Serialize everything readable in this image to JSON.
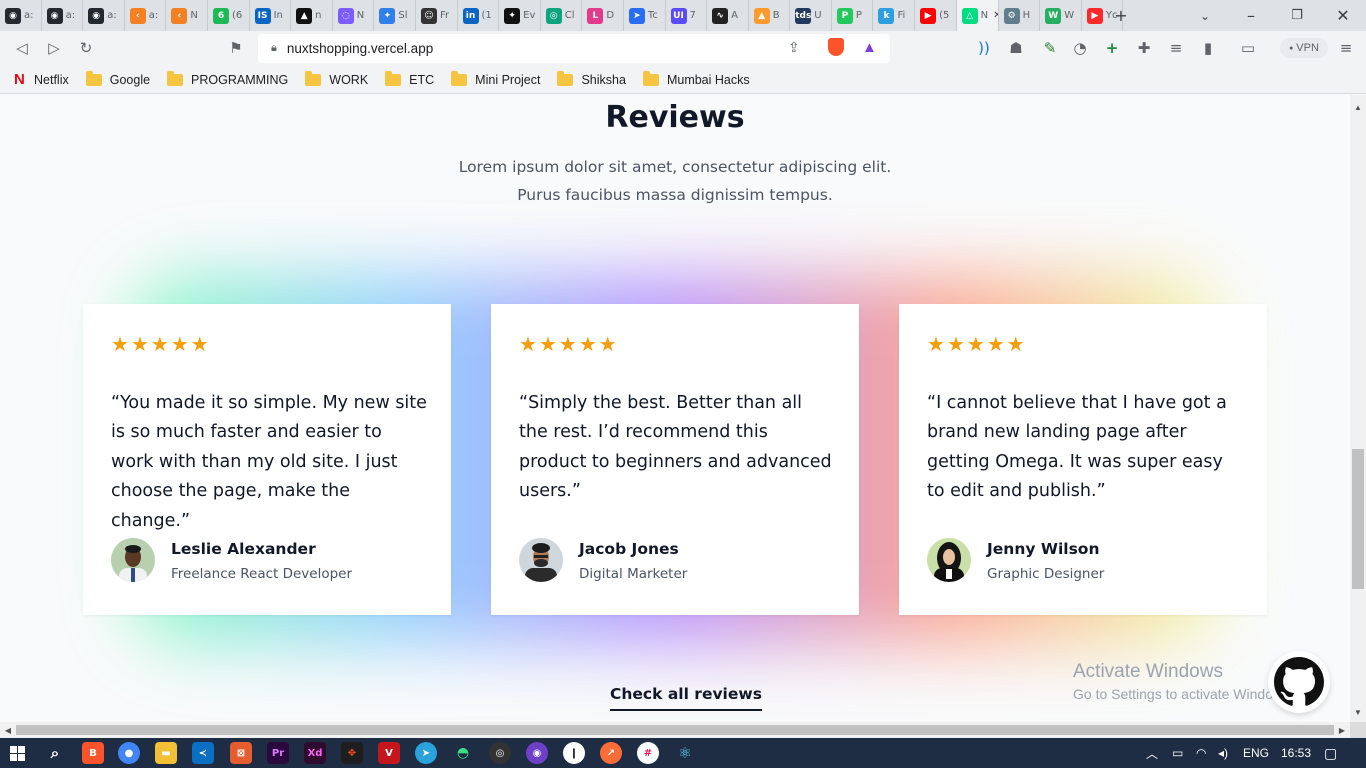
{
  "browser": {
    "tabs": [
      {
        "icon": "github-icon",
        "color": "#24292f",
        "glyph": "◉",
        "label": "a:"
      },
      {
        "icon": "github-icon",
        "color": "#24292f",
        "glyph": "◉",
        "label": "a:"
      },
      {
        "icon": "github-icon",
        "color": "#24292f",
        "glyph": "◉",
        "label": "a:"
      },
      {
        "icon": "stack-icon",
        "color": "#f48024",
        "glyph": "‹",
        "label": "a:"
      },
      {
        "icon": "stack-icon",
        "color": "#f48024",
        "glyph": "‹",
        "label": "N"
      },
      {
        "icon": "counter-icon",
        "color": "#1db954",
        "glyph": "6",
        "label": "(6"
      },
      {
        "icon": "is-icon",
        "color": "#0a66c2",
        "glyph": "IS",
        "label": "In"
      },
      {
        "icon": "triangle-icon",
        "color": "#111111",
        "glyph": "▲",
        "label": "n"
      },
      {
        "icon": "chat-icon",
        "color": "#7c5cff",
        "glyph": "◌",
        "label": "N"
      },
      {
        "icon": "sketch-icon",
        "color": "#2f80ed",
        "glyph": "✦",
        "label": "Sl"
      },
      {
        "icon": "reddit-icon",
        "color": "#333333",
        "glyph": "☺",
        "label": "Fr"
      },
      {
        "icon": "linkedin-icon",
        "color": "#0a66c2",
        "glyph": "in",
        "label": "(1"
      },
      {
        "icon": "spark-icon",
        "color": "#111111",
        "glyph": "✦",
        "label": "Ev"
      },
      {
        "icon": "chatgpt-icon",
        "color": "#10a37f",
        "glyph": "◎",
        "label": "Cl"
      },
      {
        "icon": "link-icon",
        "color": "#e23b8c",
        "glyph": "L",
        "label": "D"
      },
      {
        "icon": "telegram-icon",
        "color": "#2b6cf5",
        "glyph": "➤",
        "label": "Tc"
      },
      {
        "icon": "ui-icon",
        "color": "#5b4bff",
        "glyph": "UI",
        "label": "7"
      },
      {
        "icon": "chart-icon",
        "color": "#222222",
        "glyph": "∿",
        "label": "A"
      },
      {
        "icon": "warning-icon",
        "color": "#ff9a2f",
        "glyph": "▲",
        "label": "B"
      },
      {
        "icon": "tds-icon",
        "color": "#23395d",
        "glyph": "tds",
        "label": "U"
      },
      {
        "icon": "p-icon",
        "color": "#23c95c",
        "glyph": "P",
        "label": "P"
      },
      {
        "icon": "k-icon",
        "color": "#2f9ee0",
        "glyph": "k",
        "label": "Fi"
      },
      {
        "icon": "youtube-icon",
        "color": "#ff0000",
        "glyph": "▶",
        "label": "(5"
      },
      {
        "icon": "nuxt-icon",
        "color": "#00dc82",
        "glyph": "△",
        "label": "N",
        "active": true
      },
      {
        "icon": "robot-icon",
        "color": "#5f7d8c",
        "glyph": "⚙",
        "label": "H"
      },
      {
        "icon": "w-icon",
        "color": "#27ae60",
        "glyph": "W",
        "label": "W"
      },
      {
        "icon": "music-icon",
        "color": "#ff2a2a",
        "glyph": "▶",
        "label": "Yc"
      }
    ],
    "url": "nuxtshopping.vercel.app",
    "vpn_label": "VPN",
    "bookmarks": [
      {
        "label": "Netflix",
        "type": "netflix"
      },
      {
        "label": "Google",
        "type": "folder"
      },
      {
        "label": "PROGRAMMING",
        "type": "folder"
      },
      {
        "label": "WORK",
        "type": "folder"
      },
      {
        "label": "ETC",
        "type": "folder"
      },
      {
        "label": "Mini Project",
        "type": "folder"
      },
      {
        "label": "Shiksha",
        "type": "folder"
      },
      {
        "label": "Mumbai Hacks",
        "type": "folder"
      }
    ]
  },
  "page": {
    "title": "Reviews",
    "subtitle": "Lorem ipsum dolor sit amet, consectetur adipiscing elit. Purus faucibus massa dignissim tempus.",
    "rating_stars": 5,
    "reviews": [
      {
        "quote": "“You made it so simple. My new site is so much faster and easier to work with than my old site. I just choose the page, make the change.”",
        "name": "Leslie Alexander",
        "role": "Freelance React Developer"
      },
      {
        "quote": "“Simply the best. Better than all the rest. I’d recommend this product to beginners and advanced users.”",
        "name": "Jacob Jones",
        "role": "Digital Marketer"
      },
      {
        "quote": "“I cannot believe that I have got a brand new landing page after getting Omega. It was super easy to edit and publish.”",
        "name": "Jenny Wilson",
        "role": "Graphic Designer"
      }
    ],
    "check_all_label": "Check all reviews"
  },
  "os": {
    "watermark_title": "Activate Windows",
    "watermark_sub": "Go to Settings to activate Windows.",
    "language": "ENG",
    "time": "16:53"
  }
}
